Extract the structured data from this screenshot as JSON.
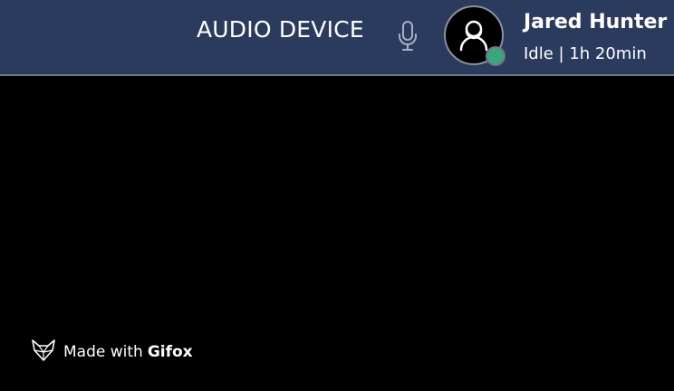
{
  "header": {
    "device_label": "AUDIO DEVICE",
    "mic_icon": "microphone-icon",
    "user": {
      "name": "Jared Hunter",
      "status_text": "Idle | 1h 20min",
      "presence_color": "#3aa67a",
      "avatar_icon": "user-avatar-icon"
    },
    "background_color": "#2a3b5e"
  },
  "watermark": {
    "prefix": "Made with",
    "brand": "Gifox",
    "icon": "fox-logo-icon"
  }
}
